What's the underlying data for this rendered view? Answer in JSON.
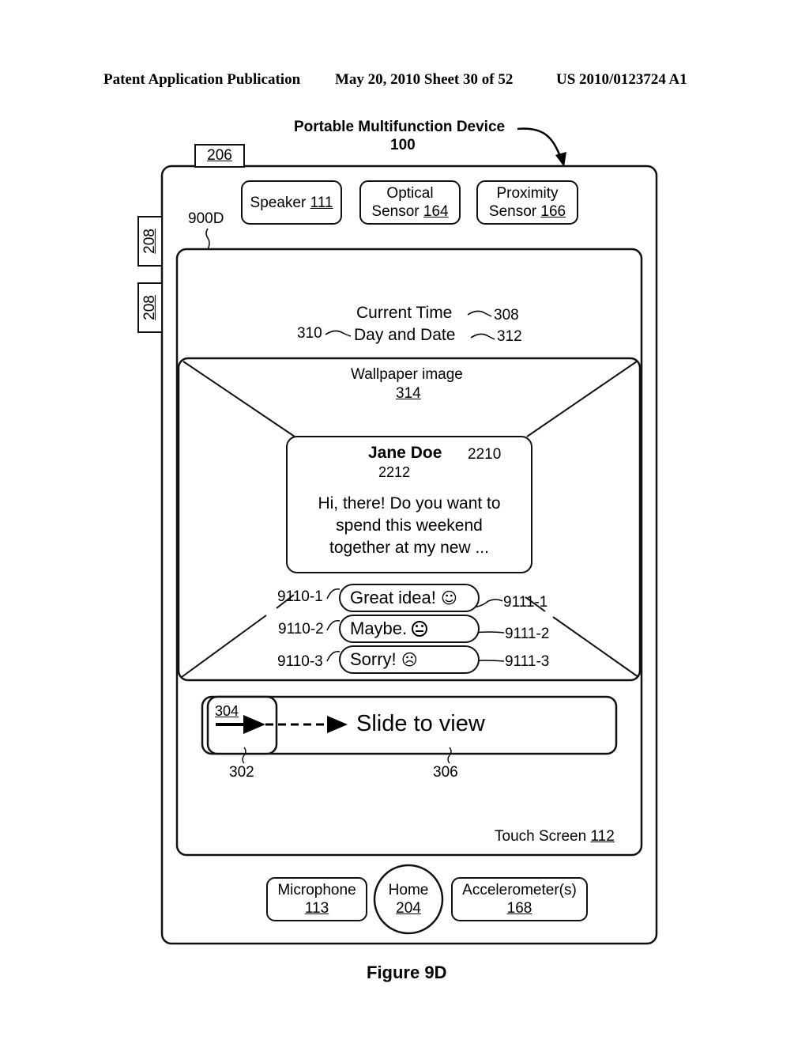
{
  "header": {
    "left": "Patent Application Publication",
    "middle": "May 20, 2010  Sheet 30 of 52",
    "right": "US 2010/0123724 A1"
  },
  "device": {
    "title": "Portable Multifunction Device",
    "ref": "100",
    "top_button_ref": "206",
    "side_button_refs": [
      "208",
      "208"
    ],
    "screen_ref": "900D"
  },
  "top_components": [
    {
      "label": "Speaker",
      "ref": "111"
    },
    {
      "label": "Optical",
      "label2": "Sensor",
      "ref": "164"
    },
    {
      "label": "Proximity",
      "label2": "Sensor",
      "ref": "166"
    }
  ],
  "screen": {
    "current_time": "Current Time",
    "current_time_ref": "308",
    "day_date": "Day and Date",
    "day_date_ref": "312",
    "left_ref": "310",
    "wallpaper_label": "Wallpaper image",
    "wallpaper_ref": "314",
    "touch_screen_label": "Touch Screen",
    "touch_screen_ref": "112"
  },
  "message": {
    "sender": "Jane Doe",
    "sender_ref": "2210",
    "body_ref": "2212",
    "lines": [
      "Hi, there! Do you want to",
      "spend this weekend",
      "together at my new ..."
    ]
  },
  "replies": [
    {
      "text": "Great idea!",
      "icon": "smiley-happy-icon",
      "glyph": "☺",
      "ref_left": "9110-1",
      "ref_right": "9111-1"
    },
    {
      "text": "Maybe.",
      "icon": "smiley-neutral-icon",
      "glyph": "😐",
      "ref_left": "9110-2",
      "ref_right": "9111-2"
    },
    {
      "text": "Sorry!",
      "icon": "smiley-sad-icon",
      "glyph": "☹",
      "ref_left": "9110-3",
      "ref_right": "9111-3"
    }
  ],
  "slider": {
    "label": "Slide to view",
    "handle_ref": "304",
    "image_ref": "302",
    "channel_ref": "306"
  },
  "bottom_components": [
    {
      "label": "Microphone",
      "ref": "113"
    },
    {
      "label": "Home",
      "ref": "204"
    },
    {
      "label": "Accelerometer(s)",
      "ref": "168"
    }
  ],
  "figure_caption": "Figure 9D"
}
